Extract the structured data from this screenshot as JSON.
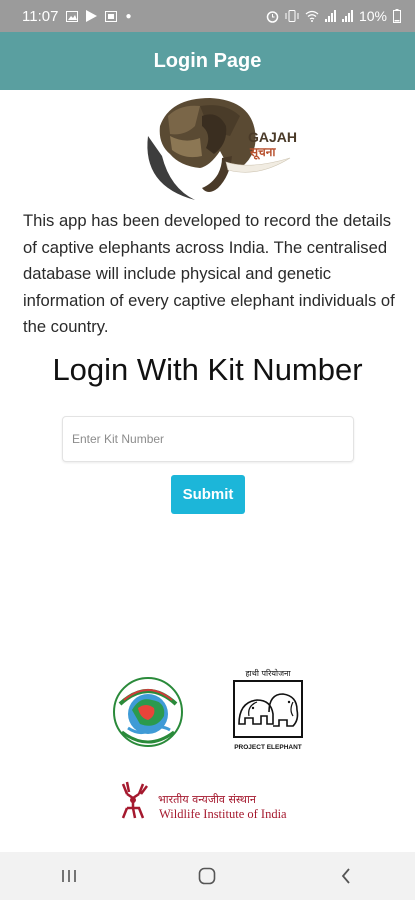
{
  "status_bar": {
    "time": "11:07",
    "battery": "10%",
    "icons": [
      "image-icon",
      "play-store-icon",
      "gallery-icon",
      "dot-icon",
      "alarm-icon",
      "vibrate-icon",
      "wifi-icon",
      "signal-icon",
      "signal-icon",
      "battery-icon"
    ]
  },
  "app_bar": {
    "title": "Login Page"
  },
  "logo": {
    "text_latin": "GAJAH",
    "text_devanagari": "सूचना",
    "colors": {
      "brown": "#4a3a28",
      "accent": "#b8512f"
    }
  },
  "description": "This app has been developed to record the details of captive elephants across India. The centralised database will include physical and genetic information of every captive elephant individuals of the country.",
  "login": {
    "heading": "Login With Kit Number",
    "kit_input": {
      "placeholder": "Enter Kit Number",
      "value": ""
    },
    "submit_label": "Submit"
  },
  "partners": {
    "moef_logo_icon": "moef-logo-icon",
    "project_elephant": {
      "top_text": "हाथी परियोजना",
      "bottom_text": "PROJECT ELEPHANT"
    },
    "wii": {
      "hindi": "भारतीय वन्यजीव संस्थान",
      "english": "Wildlife Institute of India",
      "color": "#a5192e"
    }
  },
  "nav_bar": {
    "icons": [
      "recents-icon",
      "home-icon",
      "back-icon"
    ]
  },
  "colors": {
    "app_bar": "#5a9fa0",
    "button": "#1cb6d9",
    "status_bar": "#9b9b9b"
  }
}
